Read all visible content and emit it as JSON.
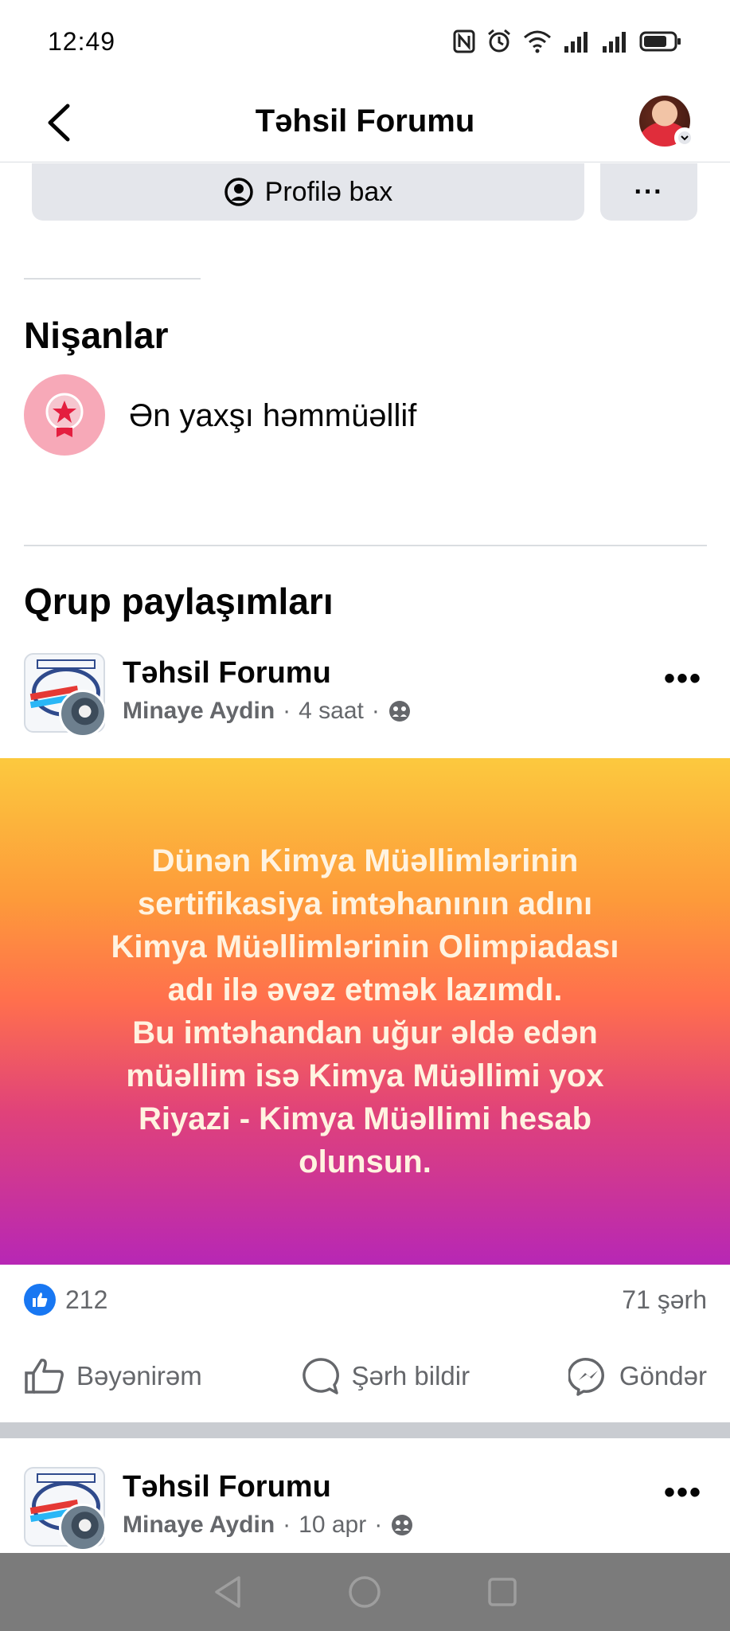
{
  "status_bar": {
    "time": "12:49",
    "icons": [
      "nfc-icon",
      "alarm-icon",
      "wifi-icon",
      "signal-icon",
      "signal-icon",
      "battery-icon"
    ]
  },
  "header": {
    "title": "Təhsil Forumu",
    "back_icon": "chevron-left-icon"
  },
  "profile_actions": {
    "view_profile_label": "Profilə bax",
    "more_label": "···"
  },
  "badges": {
    "title": "Nişanlar",
    "items": [
      {
        "label": "Ən yaxşı həmmüəllif",
        "icon": "star-badge-icon",
        "color": "#f7a9b8"
      }
    ]
  },
  "group_posts": {
    "title": "Qrup paylaşımları",
    "posts": [
      {
        "group": "Təhsil Forumu",
        "author": "Minaye Aydin",
        "time": "4 saat",
        "privacy_icon": "group-privacy-icon",
        "more_label": "•••",
        "text": "Dünən Kimya Müəllimlərinin\nsertifikasiya imtəhanının adını\nKimya Müəllimlərinin Olimpiadası\nadı ilə əvəz etmək lazımdı.\nBu imtəhandan uğur əldə edən\nmüəllim isə Kimya Müəllimi yox\nRiyazi - Kimya Müəllimi hesab\nolunsun.",
        "likes": "212",
        "comments": "71 şərh",
        "actions": {
          "like": "Bəyənirəm",
          "comment": "Şərh bildir",
          "send": "Göndər"
        }
      },
      {
        "group": "Təhsil Forumu",
        "author": "Minaye Aydin",
        "time": "10 apr",
        "privacy_icon": "group-privacy-icon",
        "more_label": "•••"
      }
    ]
  },
  "colors": {
    "accent": "#1877f2",
    "secondary_text": "#65676b",
    "button_bg": "#e4e6eb"
  }
}
